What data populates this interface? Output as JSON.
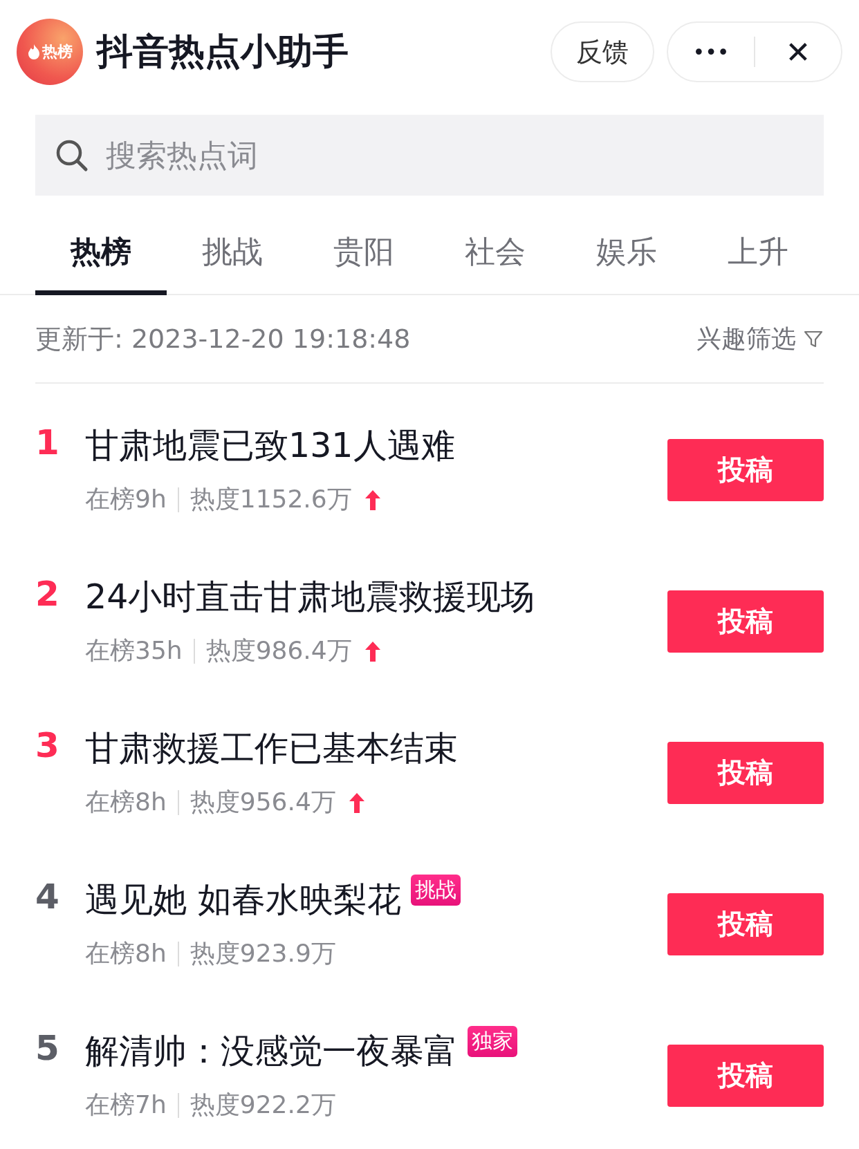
{
  "header": {
    "logo_text": "热榜",
    "title": "抖音热点小助手",
    "feedback": "反馈",
    "more": "•••",
    "close": "✕"
  },
  "search": {
    "placeholder": "搜索热点词"
  },
  "tabs": [
    {
      "label": "热榜",
      "selected": true
    },
    {
      "label": "挑战",
      "selected": false
    },
    {
      "label": "贵阳",
      "selected": false
    },
    {
      "label": "社会",
      "selected": false
    },
    {
      "label": "娱乐",
      "selected": false
    },
    {
      "label": "上升",
      "selected": false
    }
  ],
  "updated": "更新于: 2023-12-20 19:18:48",
  "filter": "兴趣筛选",
  "items": [
    {
      "rank": "1",
      "color": "#fe2c55",
      "title": "甘肃地震已致131人遇难",
      "on_list": "在榜9h",
      "heat": "热度1152.6万",
      "rising": true,
      "button": "投稿"
    },
    {
      "rank": "2",
      "color": "#fe2c55",
      "title": "24小时直击甘肃地震救援现场",
      "on_list": "在榜35h",
      "heat": "热度986.4万",
      "rising": true,
      "button": "投稿"
    },
    {
      "rank": "3",
      "color": "#fe2c55",
      "title": "甘肃救援工作已基本结束",
      "on_list": "在榜8h",
      "heat": "热度956.4万",
      "rising": true,
      "button": "投稿"
    },
    {
      "rank": "4",
      "color": "#5c5e66",
      "title": "遇见她 如春水映梨花",
      "tag": "挑战",
      "on_list": "在榜8h",
      "heat": "热度923.9万",
      "rising": false,
      "button": "投稿"
    },
    {
      "rank": "5",
      "color": "#5c5e66",
      "title": "解清帅：没感觉一夜暴富",
      "tag": "独家",
      "on_list": "在榜7h",
      "heat": "热度922.2万",
      "rising": false,
      "button": "投稿"
    }
  ]
}
